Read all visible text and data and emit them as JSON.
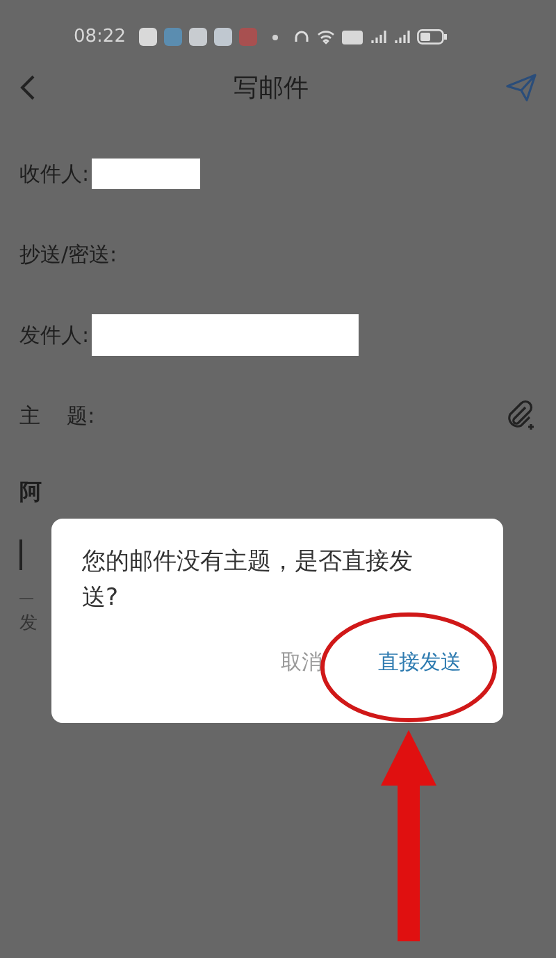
{
  "status_bar": {
    "time": "08:22"
  },
  "header": {
    "title": "写邮件"
  },
  "fields": [
    {
      "label": "收件人:",
      "kind": "redacted_short"
    },
    {
      "label": "抄送/密送:",
      "kind": "plain"
    },
    {
      "label": "发件人:",
      "kind": "redacted_long"
    },
    {
      "label": "主    题:",
      "kind": "attach"
    }
  ],
  "body": {
    "first_line": "阿",
    "footer": "发"
  },
  "dialog": {
    "message": "您的邮件没有主题，是否直接发送?",
    "buttons": [
      {
        "label": "取消",
        "kind": "cancel"
      },
      {
        "label": "直接发送",
        "kind": "confirm"
      }
    ]
  }
}
